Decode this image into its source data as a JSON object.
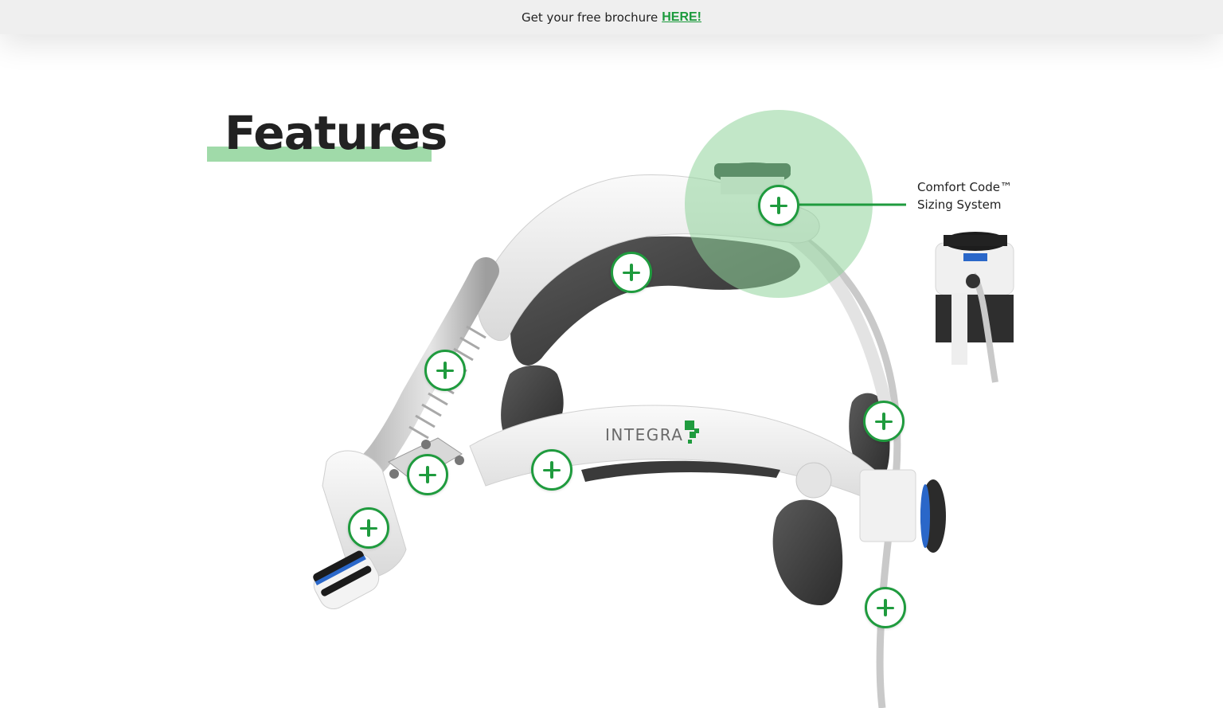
{
  "banner": {
    "text": "Get your free brochure",
    "link_label": "HERE!"
  },
  "section": {
    "title": "Features"
  },
  "product": {
    "brand_mark": "INTEGRA"
  },
  "callout": {
    "line1": "Comfort Code™",
    "line2": "Sizing System"
  },
  "hotspots": [
    {
      "name": "hotspot-comfort-code",
      "state": "active"
    },
    {
      "name": "hotspot-top-pad"
    },
    {
      "name": "hotspot-hose"
    },
    {
      "name": "hotspot-rear-pad"
    },
    {
      "name": "hotspot-headband"
    },
    {
      "name": "hotspot-mount"
    },
    {
      "name": "hotspot-light-head"
    },
    {
      "name": "hotspot-cable"
    }
  ],
  "colors": {
    "accent": "#1f9b3e",
    "highlight": "#8fd39a",
    "banner_bg": "#efefef"
  }
}
